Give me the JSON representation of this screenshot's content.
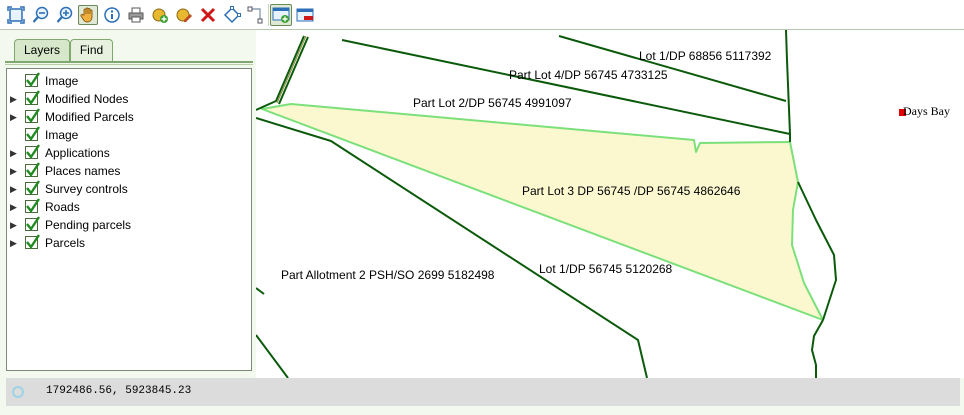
{
  "toolbar": {
    "buttons": [
      {
        "icon": "zoom-extent-icon"
      },
      {
        "icon": "zoom-out-icon"
      },
      {
        "icon": "zoom-in-icon"
      },
      {
        "icon": "pan-hand-icon",
        "pressed": true
      },
      {
        "icon": "info-icon"
      },
      {
        "icon": "print-icon"
      },
      {
        "icon": "add-point-icon"
      },
      {
        "icon": "edit-point-icon"
      },
      {
        "icon": "delete-icon"
      },
      {
        "icon": "draw-polygon-icon"
      },
      {
        "icon": "draw-line-icon"
      },
      {
        "icon": "add-layer-icon",
        "pressed": true
      },
      {
        "icon": "remove-layer-icon"
      }
    ]
  },
  "panel": {
    "tabs": [
      {
        "label": "Layers",
        "active": true
      },
      {
        "label": "Find",
        "active": false
      }
    ],
    "layers": [
      {
        "label": "Image",
        "checked": true,
        "expandable": false
      },
      {
        "label": "Modified Nodes",
        "checked": true,
        "expandable": true
      },
      {
        "label": "Modified Parcels",
        "checked": true,
        "expandable": true
      },
      {
        "label": "Image",
        "checked": true,
        "expandable": false
      },
      {
        "label": "Applications",
        "checked": true,
        "expandable": true
      },
      {
        "label": "Places names",
        "checked": true,
        "expandable": true
      },
      {
        "label": "Survey controls",
        "checked": true,
        "expandable": true
      },
      {
        "label": "Roads",
        "checked": true,
        "expandable": true
      },
      {
        "label": "Pending parcels",
        "checked": true,
        "expandable": true
      },
      {
        "label": "Parcels",
        "checked": true,
        "expandable": true
      }
    ]
  },
  "map": {
    "parcel_labels": [
      "Lot 1/DP 68856 5117392",
      "Part Lot 4/DP 56745 4733125",
      "Part Lot 2/DP 56745 4991097",
      "Part Lot 3 DP 56745 /DP 56745 4862646",
      "Lot 1/DP 56745 5120268",
      "Part Allotment 2 PSH/SO 2699 5182498"
    ],
    "place_name": "Days Bay",
    "colors": {
      "parcel_line": "#0b5a0b",
      "selected_fill": "#fbf8d0",
      "selected_outline": "#7ce07a",
      "place_marker": "#e00000"
    }
  },
  "status": {
    "coordinates": "1792486.56, 5923845.23"
  }
}
